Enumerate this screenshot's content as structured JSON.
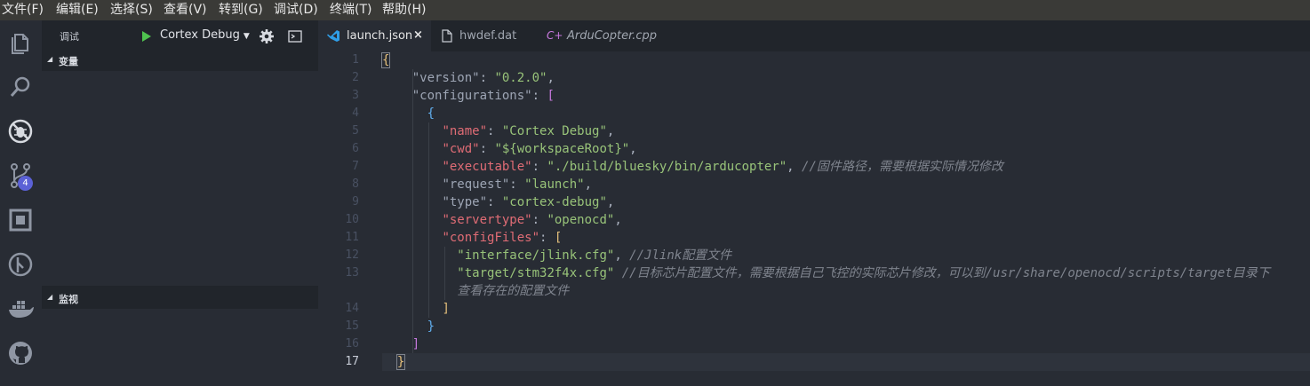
{
  "menu": [
    "文件(F)",
    "编辑(E)",
    "选择(S)",
    "查看(V)",
    "转到(G)",
    "调试(D)",
    "终端(T)",
    "帮助(H)"
  ],
  "activity": {
    "scm_badge": "4"
  },
  "sidebar": {
    "title": "调试",
    "config": "Cortex Debug",
    "sections": {
      "variables": "变量",
      "watch": "监视"
    }
  },
  "tabs": [
    {
      "label": "launch.json",
      "close": "×"
    },
    {
      "label": "hwdef.dat"
    },
    {
      "label": "ArduCopter.cpp"
    }
  ],
  "editor": {
    "line_numbers": [
      "1",
      "2",
      "3",
      "4",
      "5",
      "6",
      "7",
      "8",
      "9",
      "10",
      "11",
      "12",
      "13",
      "14",
      "15",
      "16",
      "17"
    ],
    "lines": [
      {
        "ln": "1",
        "indent": "",
        "parts": [
          [
            "b1",
            "{"
          ]
        ]
      },
      {
        "ln": "2",
        "indent": "    ",
        "parts": [
          [
            "kg",
            "\"version\""
          ],
          [
            "p",
            ": "
          ],
          [
            "s",
            "\"0.2.0\""
          ],
          [
            "p",
            ","
          ]
        ]
      },
      {
        "ln": "3",
        "indent": "    ",
        "parts": [
          [
            "kg",
            "\"configurations\""
          ],
          [
            "p",
            ": "
          ],
          [
            "b2",
            "["
          ]
        ]
      },
      {
        "ln": "4",
        "indent": "      ",
        "parts": [
          [
            "b3",
            "{"
          ]
        ]
      },
      {
        "ln": "5",
        "indent": "        ",
        "parts": [
          [
            "k",
            "\"name\""
          ],
          [
            "p",
            ": "
          ],
          [
            "s",
            "\"Cortex Debug\""
          ],
          [
            "p",
            ","
          ]
        ]
      },
      {
        "ln": "6",
        "indent": "        ",
        "parts": [
          [
            "k",
            "\"cwd\""
          ],
          [
            "p",
            ": "
          ],
          [
            "s",
            "\"${workspaceRoot}\""
          ],
          [
            "p",
            ","
          ]
        ]
      },
      {
        "ln": "7",
        "indent": "        ",
        "parts": [
          [
            "k",
            "\"executable\""
          ],
          [
            "p",
            ": "
          ],
          [
            "s",
            "\"./build/bluesky/bin/arducopter\""
          ],
          [
            "p",
            ", "
          ],
          [
            "c",
            "//固件路径，需要根据实际情况修改"
          ]
        ]
      },
      {
        "ln": "8",
        "indent": "        ",
        "parts": [
          [
            "kg",
            "\"request\""
          ],
          [
            "p",
            ": "
          ],
          [
            "s",
            "\"launch\""
          ],
          [
            "p",
            ","
          ]
        ]
      },
      {
        "ln": "9",
        "indent": "        ",
        "parts": [
          [
            "kg",
            "\"type\""
          ],
          [
            "p",
            ": "
          ],
          [
            "s",
            "\"cortex-debug\""
          ],
          [
            "p",
            ","
          ]
        ]
      },
      {
        "ln": "10",
        "indent": "        ",
        "parts": [
          [
            "k",
            "\"servertype\""
          ],
          [
            "p",
            ": "
          ],
          [
            "s",
            "\"openocd\""
          ],
          [
            "p",
            ","
          ]
        ]
      },
      {
        "ln": "11",
        "indent": "        ",
        "parts": [
          [
            "k",
            "\"configFiles\""
          ],
          [
            "p",
            ": "
          ],
          [
            "b1",
            "["
          ]
        ]
      },
      {
        "ln": "12",
        "indent": "          ",
        "parts": [
          [
            "s",
            "\"interface/jlink.cfg\""
          ],
          [
            "p",
            ", "
          ],
          [
            "c",
            "//Jlink配置文件"
          ]
        ]
      },
      {
        "ln": "13",
        "indent": "          ",
        "parts": [
          [
            "s",
            "\"target/stm32f4x.cfg\""
          ],
          [
            "p",
            " "
          ],
          [
            "c",
            "//目标芯片配置文件，需要根据自己飞控的实际芯片修改，可以到/usr/share/openocd/scripts/target目录下"
          ]
        ]
      },
      {
        "ln": "",
        "indent": "          ",
        "parts": [
          [
            "c",
            "查看存在的配置文件"
          ]
        ]
      },
      {
        "ln": "14",
        "indent": "        ",
        "parts": [
          [
            "b1",
            "]"
          ]
        ]
      },
      {
        "ln": "15",
        "indent": "      ",
        "parts": [
          [
            "b3",
            "}"
          ]
        ]
      },
      {
        "ln": "16",
        "indent": "    ",
        "parts": [
          [
            "b2",
            "]"
          ]
        ]
      },
      {
        "ln": "17",
        "indent": "  ",
        "parts": [
          [
            "b1",
            "}"
          ]
        ]
      }
    ]
  }
}
